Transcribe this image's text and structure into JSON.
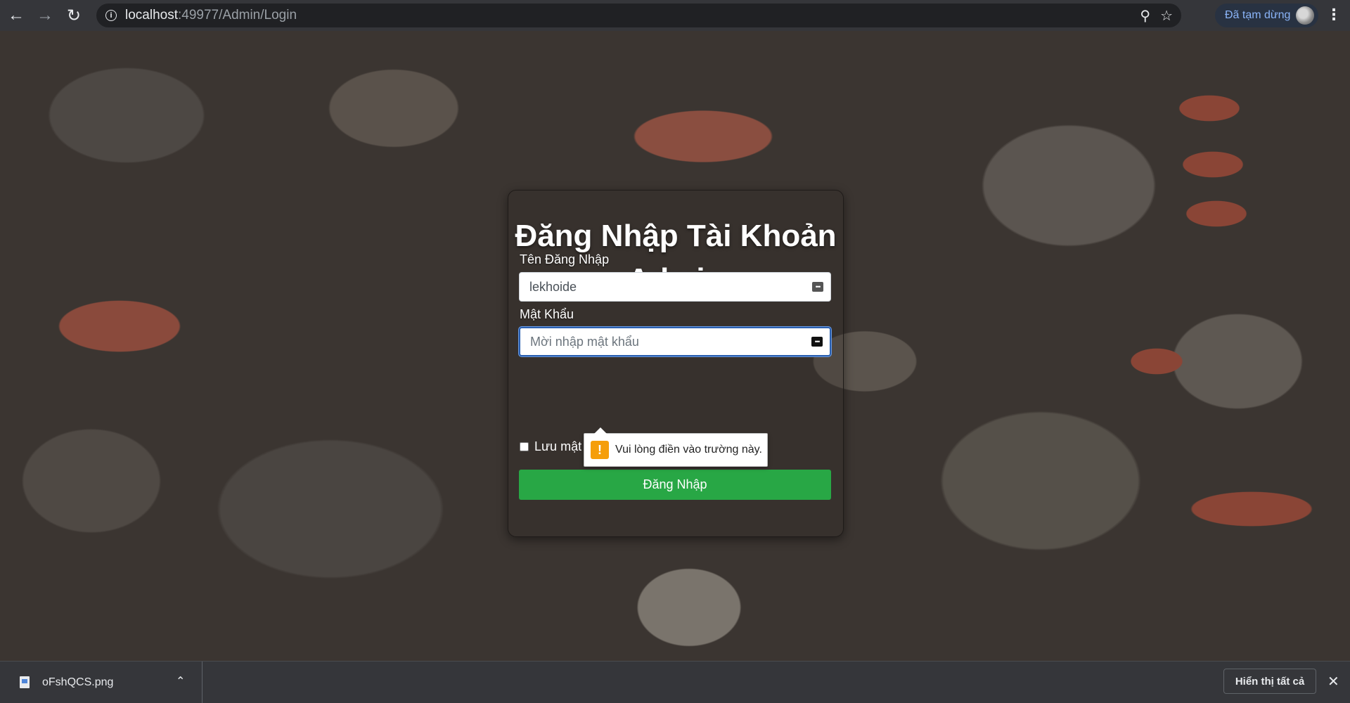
{
  "browser": {
    "url_host": "localhost",
    "url_rest": ":49977/Admin/Login",
    "profile_label": "Đã tạm dừng"
  },
  "icons": {
    "back": "back-arrow-icon",
    "forward": "forward-arrow-icon",
    "reload": "reload-icon",
    "info": "info-icon",
    "zoom": "zoom-icon",
    "bookmark": "star-icon",
    "menu": "kebab-menu-icon",
    "warning": "warning-icon",
    "file": "image-file-icon"
  },
  "login": {
    "title": "Đăng Nhập Tài Khoản Admin",
    "username_label": "Tên Đăng Nhập",
    "username_value": "lekhoide",
    "password_label": "Mật Khẩu",
    "password_placeholder": "Mời nhập mật khẩu",
    "remember_label": "Lưu mật",
    "submit_label": "Đăng Nhập",
    "validation_message": "Vui lòng điền vào trường này."
  },
  "downloads": {
    "file_name": "oFshQCS.png",
    "show_all_label": "Hiển thị tất cả"
  },
  "colors": {
    "submit": "#28a745",
    "chrome": "#35363a",
    "warning": "#f59e0b"
  }
}
